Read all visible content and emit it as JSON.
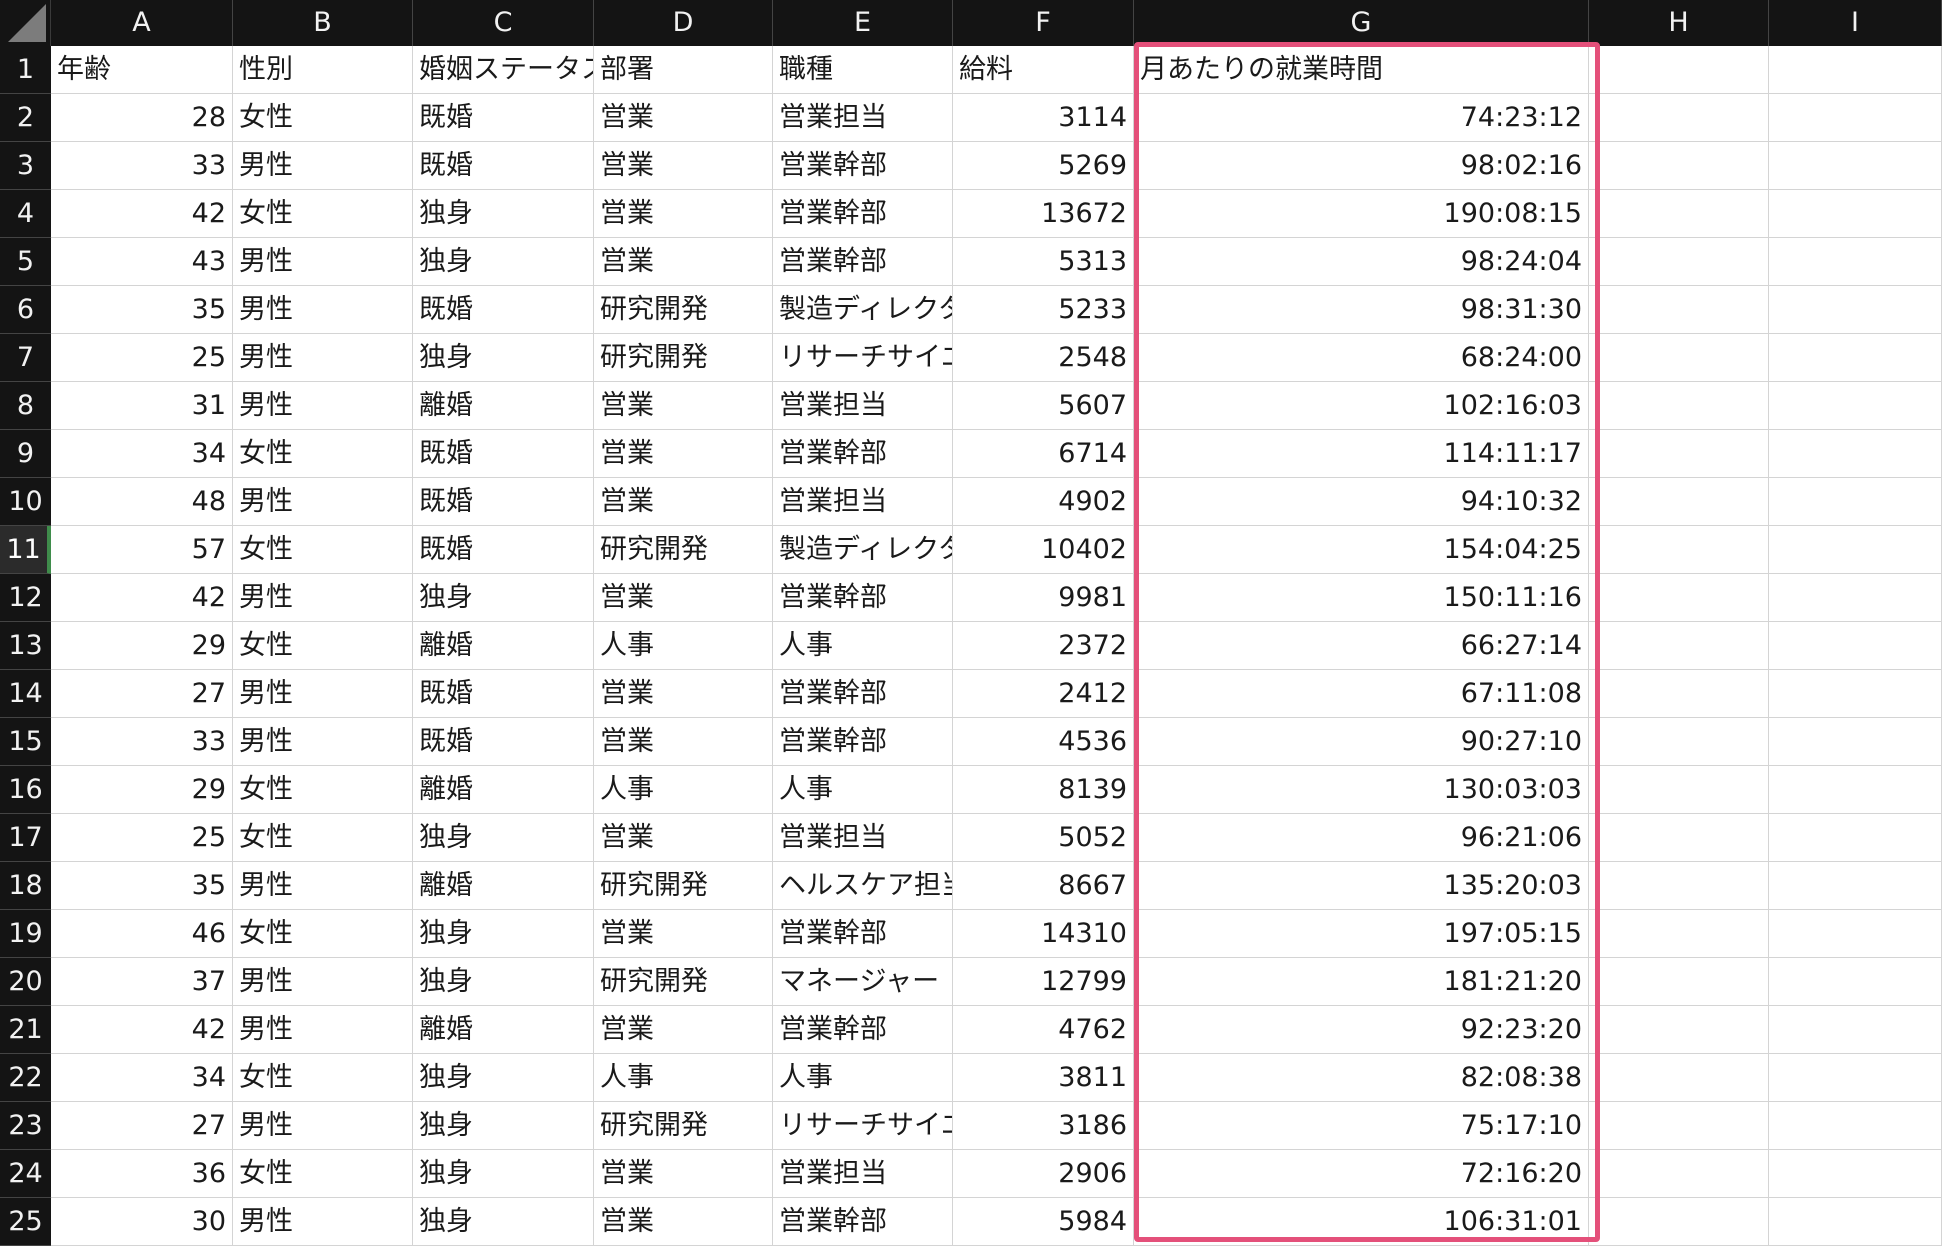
{
  "columns": [
    "A",
    "B",
    "C",
    "D",
    "E",
    "F",
    "G",
    "H",
    "I"
  ],
  "headers": [
    "年齢",
    "性別",
    "婚姻ステータス",
    "部署",
    "職種",
    "給料",
    "月あたりの就業時間",
    "",
    ""
  ],
  "rows": [
    [
      "28",
      "女性",
      "既婚",
      "営業",
      "営業担当",
      "3114",
      "74:23:12"
    ],
    [
      "33",
      "男性",
      "既婚",
      "営業",
      "営業幹部",
      "5269",
      "98:02:16"
    ],
    [
      "42",
      "女性",
      "独身",
      "営業",
      "営業幹部",
      "13672",
      "190:08:15"
    ],
    [
      "43",
      "男性",
      "独身",
      "営業",
      "営業幹部",
      "5313",
      "98:24:04"
    ],
    [
      "35",
      "男性",
      "既婚",
      "研究開発",
      "製造ディレクター",
      "5233",
      "98:31:30"
    ],
    [
      "25",
      "男性",
      "独身",
      "研究開発",
      "リサーチサイエンティスト",
      "2548",
      "68:24:00"
    ],
    [
      "31",
      "男性",
      "離婚",
      "営業",
      "営業担当",
      "5607",
      "102:16:03"
    ],
    [
      "34",
      "女性",
      "既婚",
      "営業",
      "営業幹部",
      "6714",
      "114:11:17"
    ],
    [
      "48",
      "男性",
      "既婚",
      "営業",
      "営業担当",
      "4902",
      "94:10:32"
    ],
    [
      "57",
      "女性",
      "既婚",
      "研究開発",
      "製造ディレクター",
      "10402",
      "154:04:25"
    ],
    [
      "42",
      "男性",
      "独身",
      "営業",
      "営業幹部",
      "9981",
      "150:11:16"
    ],
    [
      "29",
      "女性",
      "離婚",
      "人事",
      "人事",
      "2372",
      "66:27:14"
    ],
    [
      "27",
      "男性",
      "既婚",
      "営業",
      "営業幹部",
      "2412",
      "67:11:08"
    ],
    [
      "33",
      "男性",
      "既婚",
      "営業",
      "営業幹部",
      "4536",
      "90:27:10"
    ],
    [
      "29",
      "女性",
      "離婚",
      "人事",
      "人事",
      "8139",
      "130:03:03"
    ],
    [
      "25",
      "女性",
      "独身",
      "営業",
      "営業担当",
      "5052",
      "96:21:06"
    ],
    [
      "35",
      "男性",
      "離婚",
      "研究開発",
      "ヘルスケア担当",
      "8667",
      "135:20:03"
    ],
    [
      "46",
      "女性",
      "独身",
      "営業",
      "営業幹部",
      "14310",
      "197:05:15"
    ],
    [
      "37",
      "男性",
      "独身",
      "研究開発",
      "マネージャー",
      "12799",
      "181:21:20"
    ],
    [
      "42",
      "男性",
      "離婚",
      "営業",
      "営業幹部",
      "4762",
      "92:23:20"
    ],
    [
      "34",
      "女性",
      "独身",
      "人事",
      "人事",
      "3811",
      "82:08:38"
    ],
    [
      "27",
      "男性",
      "独身",
      "研究開発",
      "リサーチサイエンティスト",
      "3186",
      "75:17:10"
    ],
    [
      "36",
      "女性",
      "独身",
      "営業",
      "営業担当",
      "2906",
      "72:16:20"
    ],
    [
      "30",
      "男性",
      "独身",
      "営業",
      "営業幹部",
      "5984",
      "106:31:01"
    ]
  ],
  "active_row": 11,
  "colors": {
    "header_bg": "#141414",
    "highlight": "#e4507a",
    "active_row_marker": "#3f8c4b"
  }
}
